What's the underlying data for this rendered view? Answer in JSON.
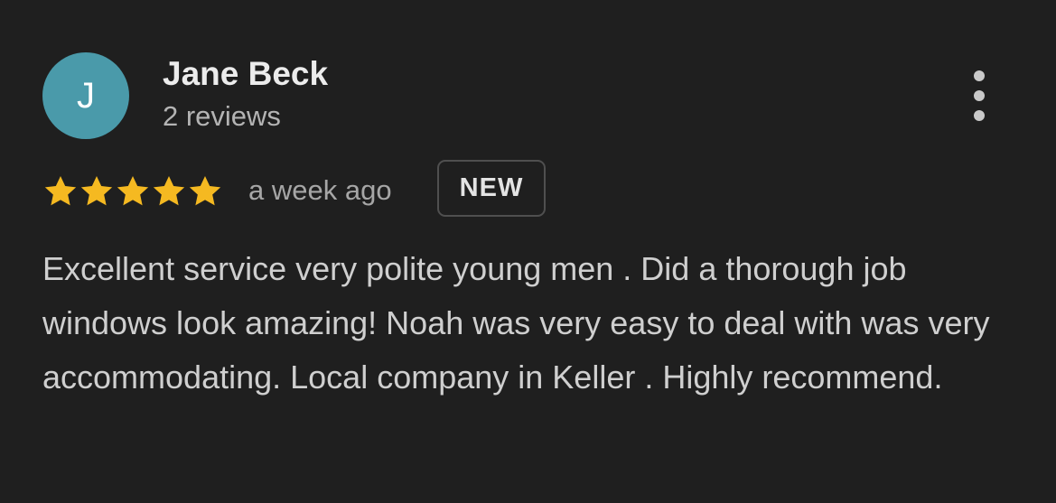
{
  "reviewer": {
    "avatar_initial": "J",
    "avatar_color": "#4a9aaa",
    "name": "Jane Beck",
    "review_count_text": "2 reviews"
  },
  "menu": {
    "icon": "more-vert-icon"
  },
  "rating": {
    "stars": 5,
    "max_stars": 5,
    "star_color": "#f5b921",
    "time_ago": "a week ago",
    "badge": "NEW"
  },
  "review": {
    "text": "Excellent service very polite young men . Did a thorough job windows look amazing! Noah was very easy to deal with was very accommodating. Local company in Keller . Highly recommend."
  }
}
